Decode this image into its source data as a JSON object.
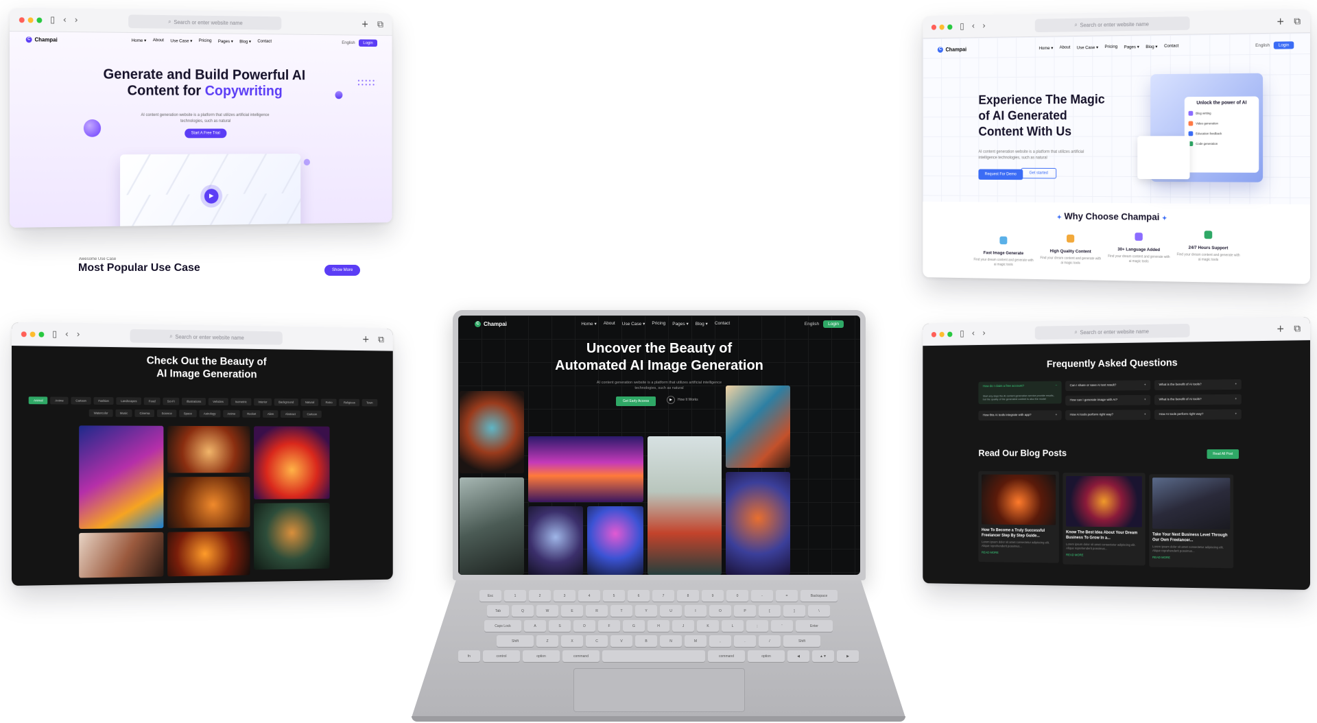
{
  "browser": {
    "url_placeholder": "Search or enter website name"
  },
  "nav": {
    "brand": "Champai",
    "links": [
      "Home ▾",
      "About",
      "Use Case ▾",
      "Pricing",
      "Pages ▾",
      "Blog ▾",
      "Contact"
    ],
    "language": "English",
    "login": "Login"
  },
  "win1": {
    "title_line1": "Generate and Build Powerful AI",
    "title_line2": "Content for",
    "title_highlight": "Copywriting",
    "subtitle": "AI content generation website is a platform that utilizes artificial intelligence technologies, such as natural",
    "cta": "Start A Free Trial",
    "usecase_label": "Awesome Use Case",
    "usecase_title": "Most Popular Use Case",
    "usecase_button": "Show More"
  },
  "win2": {
    "title_line1": "Experience The Magic",
    "title_line2": "of AI Generated",
    "title_line3": "Content With Us",
    "subtitle": "AI content generation website is a platform that utilizes artificial intelligence technologies, such as natural",
    "btn_primary": "Request For Demo",
    "btn_secondary": "Get started",
    "panel_title": "Unlock the power of AI",
    "panel_rows": [
      "Blog writing",
      "Video generation",
      "Education feedback",
      "Code generation"
    ],
    "why_title": "Why Choose Champai",
    "features": [
      {
        "title": "Fast Image Generate",
        "desc": "Find your dream content and generate with ai magic tools"
      },
      {
        "title": "High Quality Content",
        "desc": "Find your dream content and generate with ai magic tools"
      },
      {
        "title": "30+ Language Added",
        "desc": "Find your dream content and generate with ai magic tools"
      },
      {
        "title": "24/7 Hours Support",
        "desc": "Find your dream content and generate with ai magic tools"
      }
    ]
  },
  "win3": {
    "title_line1": "Check Out the Beauty of",
    "title_line2": "AI Image Generation",
    "chips_row1": [
      "Animal",
      "Anime",
      "Cartoon",
      "Fashion",
      "Landscapes",
      "Food",
      "Sci-Fi",
      "Illustrations",
      "Vehicles",
      "Isometric",
      "Interior",
      "Background",
      "Natural",
      "Retro",
      "Religious",
      "Town"
    ],
    "chips_row2": [
      "Watercolor",
      "Music",
      "Cinema",
      "Science",
      "Space",
      "Astrology",
      "Anime",
      "Rocket",
      "Alien",
      "Abstract",
      "Cartoon"
    ]
  },
  "laptop": {
    "title_line1": "Uncover the Beauty of",
    "title_line2": "Automated AI Image Generation",
    "subtitle": "AI content generation website is a platform that utilizes artificial intelligence technologies, such as natural",
    "cta": "Get Early Access",
    "how": "How It Works",
    "keys_row1": [
      "Esc",
      "1",
      "2",
      "3",
      "4",
      "5",
      "6",
      "7",
      "8",
      "9",
      "0",
      "-",
      "=",
      "Backspace"
    ],
    "keys_row2": [
      "Tab",
      "Q",
      "W",
      "E",
      "R",
      "T",
      "Y",
      "U",
      "I",
      "O",
      "P",
      "[",
      "]",
      "\\"
    ],
    "keys_row3": [
      "Caps Lock",
      "A",
      "S",
      "D",
      "F",
      "G",
      "H",
      "J",
      "K",
      "L",
      ";",
      "'",
      "Enter"
    ],
    "keys_row4": [
      "Shift",
      "Z",
      "X",
      "C",
      "V",
      "B",
      "N",
      "M",
      ",",
      ".",
      "/",
      "Shift"
    ],
    "keys_row5": [
      "fn",
      "control",
      "option",
      "command",
      "",
      "command",
      "option",
      "◀",
      "▲▼",
      "▶"
    ]
  },
  "win4": {
    "faq_title": "Frequently Asked Questions",
    "faq_open": {
      "q": "How do I claim a free account?",
      "a": "Start any days the AI content generation service provide results, but the quality of the generated content is also the model"
    },
    "faqs": [
      "Can I share or save AI text result?",
      "What is the benefit of AI tools?",
      "How can I generate image with AI?",
      "What is the benefit of AI tools?",
      "How this AI tools integrate with app?",
      "How AI tools perform right way?",
      "How AI tools perform right way?"
    ],
    "blog_title": "Read Our Blog Posts",
    "blog_button": "Read All Post",
    "blogs": [
      {
        "title": "How To Become a Truly Successful Freelancer Step By Step Guide...",
        "desc": "Lorem ipsum dolor sit amet consectetur adipiscing elit. Alique reprehenderit possimus...",
        "more": "READ MORE"
      },
      {
        "title": "Know The Best Idea About Your Dream Business To Grow In a...",
        "desc": "Lorem ipsum dolor sit amet consectetur adipiscing elit. Alique reprehenderit possimus...",
        "more": "READ MORE"
      },
      {
        "title": "Take Your Next Business Level Through Our Own Freelancer...",
        "desc": "Lorem ipsum dolor sit amet consectetur adipiscing elit. Alique reprehenderit possimus...",
        "more": "READ MORE"
      }
    ]
  },
  "colors": {
    "purple_accent": "#5b3df5",
    "blue_accent": "#3b6cf5",
    "green_accent": "#2fa866"
  }
}
